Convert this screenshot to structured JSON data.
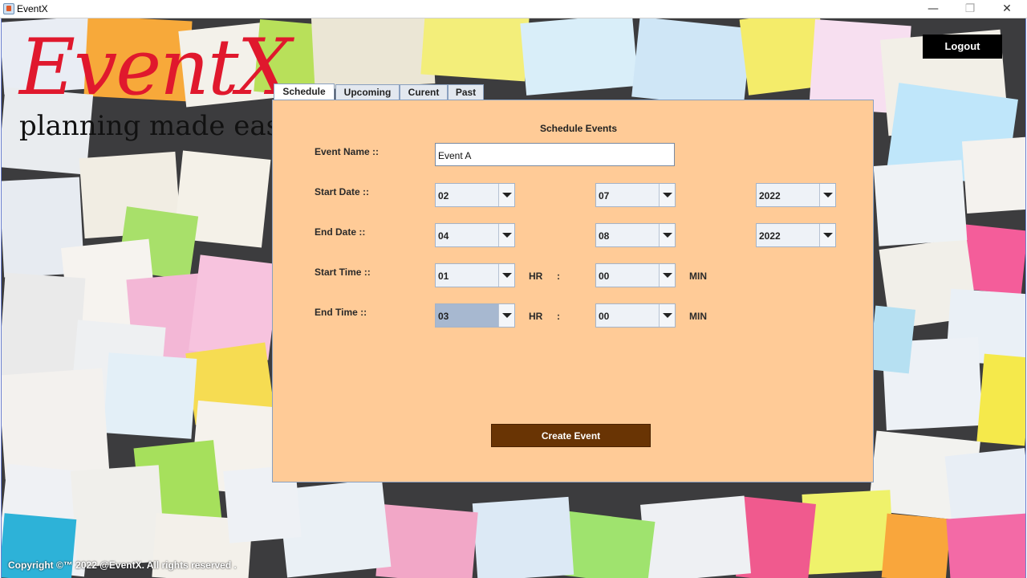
{
  "window": {
    "title": "EventX",
    "minimize_glyph": "—",
    "maximize_glyph": "❐",
    "close_glyph": "✕"
  },
  "logo": {
    "name": "EventX",
    "tagline": "planning made easy",
    "color": "#e0182d"
  },
  "header": {
    "logout_label": "Logout"
  },
  "tabs": [
    {
      "label": "Schedule",
      "active": true
    },
    {
      "label": "Upcoming",
      "active": false
    },
    {
      "label": "Curent",
      "active": false
    },
    {
      "label": "Past",
      "active": false
    }
  ],
  "form": {
    "title": "Schedule Events",
    "event_name": {
      "label": "Event Name ::",
      "value": "Event A"
    },
    "start_date": {
      "label": "Start Date ::",
      "day": "02",
      "month": "07",
      "year": "2022"
    },
    "end_date": {
      "label": "End Date ::",
      "day": "04",
      "month": "08",
      "year": "2022"
    },
    "start_time": {
      "label": "Start Time ::",
      "hour": "01",
      "hr_label": "HR",
      "sep": ":",
      "minute": "00",
      "min_label": "MIN"
    },
    "end_time": {
      "label": "End Time ::",
      "hour": "03",
      "hr_label": "HR",
      "sep": ":",
      "minute": "00",
      "min_label": "MIN"
    },
    "create_label": "Create Event"
  },
  "footer": {
    "copyright": "Copyright ©™ 2022 @EventX. All rights reserved ."
  },
  "colors": {
    "panel_bg": "#ffcb97",
    "button_bg": "#693404",
    "logout_bg": "#000000"
  }
}
